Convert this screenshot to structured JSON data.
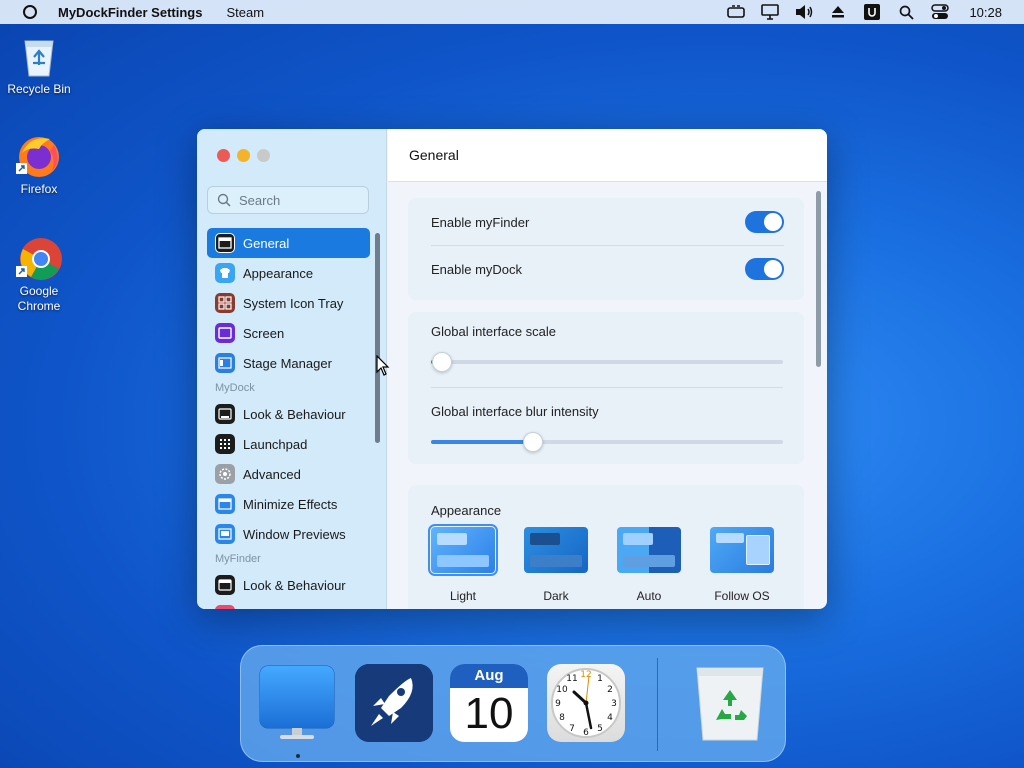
{
  "menubar": {
    "app_name": "MyDockFinder Settings",
    "menu_items": [
      "Steam"
    ],
    "clock": "10:28",
    "tray_icons": [
      "gamepad-icon",
      "monitor-icon",
      "volume-icon",
      "eject-icon",
      "u-app-icon",
      "search-icon",
      "control-center-icon"
    ]
  },
  "desktop": {
    "icons": [
      {
        "label": "Recycle Bin",
        "icon": "recycle-bin-icon"
      },
      {
        "label": "Firefox",
        "icon": "firefox-icon"
      },
      {
        "label": "Google Chrome",
        "icon": "chrome-icon"
      }
    ]
  },
  "window": {
    "title": "General",
    "search_placeholder": "Search",
    "sidebar": {
      "items": [
        {
          "label": "General",
          "active": true,
          "icon": "general-icon"
        },
        {
          "label": "Appearance",
          "icon": "appearance-icon"
        },
        {
          "label": "System Icon Tray",
          "icon": "system-icon-tray-icon"
        },
        {
          "label": "Screen",
          "icon": "screen-icon"
        },
        {
          "label": "Stage Manager",
          "icon": "stage-manager-icon"
        }
      ],
      "section_mydock": "MyDock",
      "mydock_items": [
        {
          "label": "Look & Behaviour",
          "icon": "look-behaviour-icon"
        },
        {
          "label": "Launchpad",
          "icon": "launchpad-icon"
        },
        {
          "label": "Advanced",
          "icon": "advanced-gear-icon"
        },
        {
          "label": "Minimize Effects",
          "icon": "minimize-effects-icon"
        },
        {
          "label": "Window Previews",
          "icon": "window-previews-icon"
        }
      ],
      "section_myfinder": "MyFinder",
      "myfinder_items": [
        {
          "label": "Look & Behaviour",
          "icon": "look-behaviour-icon"
        }
      ]
    },
    "toggles": [
      {
        "label": "Enable myFinder",
        "on": true
      },
      {
        "label": "Enable myDock",
        "on": true
      }
    ],
    "sliders": [
      {
        "label": "Global interface scale",
        "value": 0.03
      },
      {
        "label": "Global interface blur intensity",
        "value": 0.29
      }
    ],
    "appearance": {
      "title": "Appearance",
      "options": [
        "Light",
        "Dark",
        "Auto",
        "Follow OS"
      ],
      "selected": "Light"
    }
  },
  "dock": {
    "items": [
      "finder-monitor-icon",
      "launchpad-rocket-icon",
      "calendar-icon",
      "clock-icon",
      "trash-icon"
    ],
    "calendar_month": "Aug",
    "calendar_day": "10"
  },
  "colors": {
    "accent": "#1a7ae0",
    "close": "#ec5a55",
    "minimize": "#f3b42b",
    "zoom": "#c9c9c9"
  }
}
